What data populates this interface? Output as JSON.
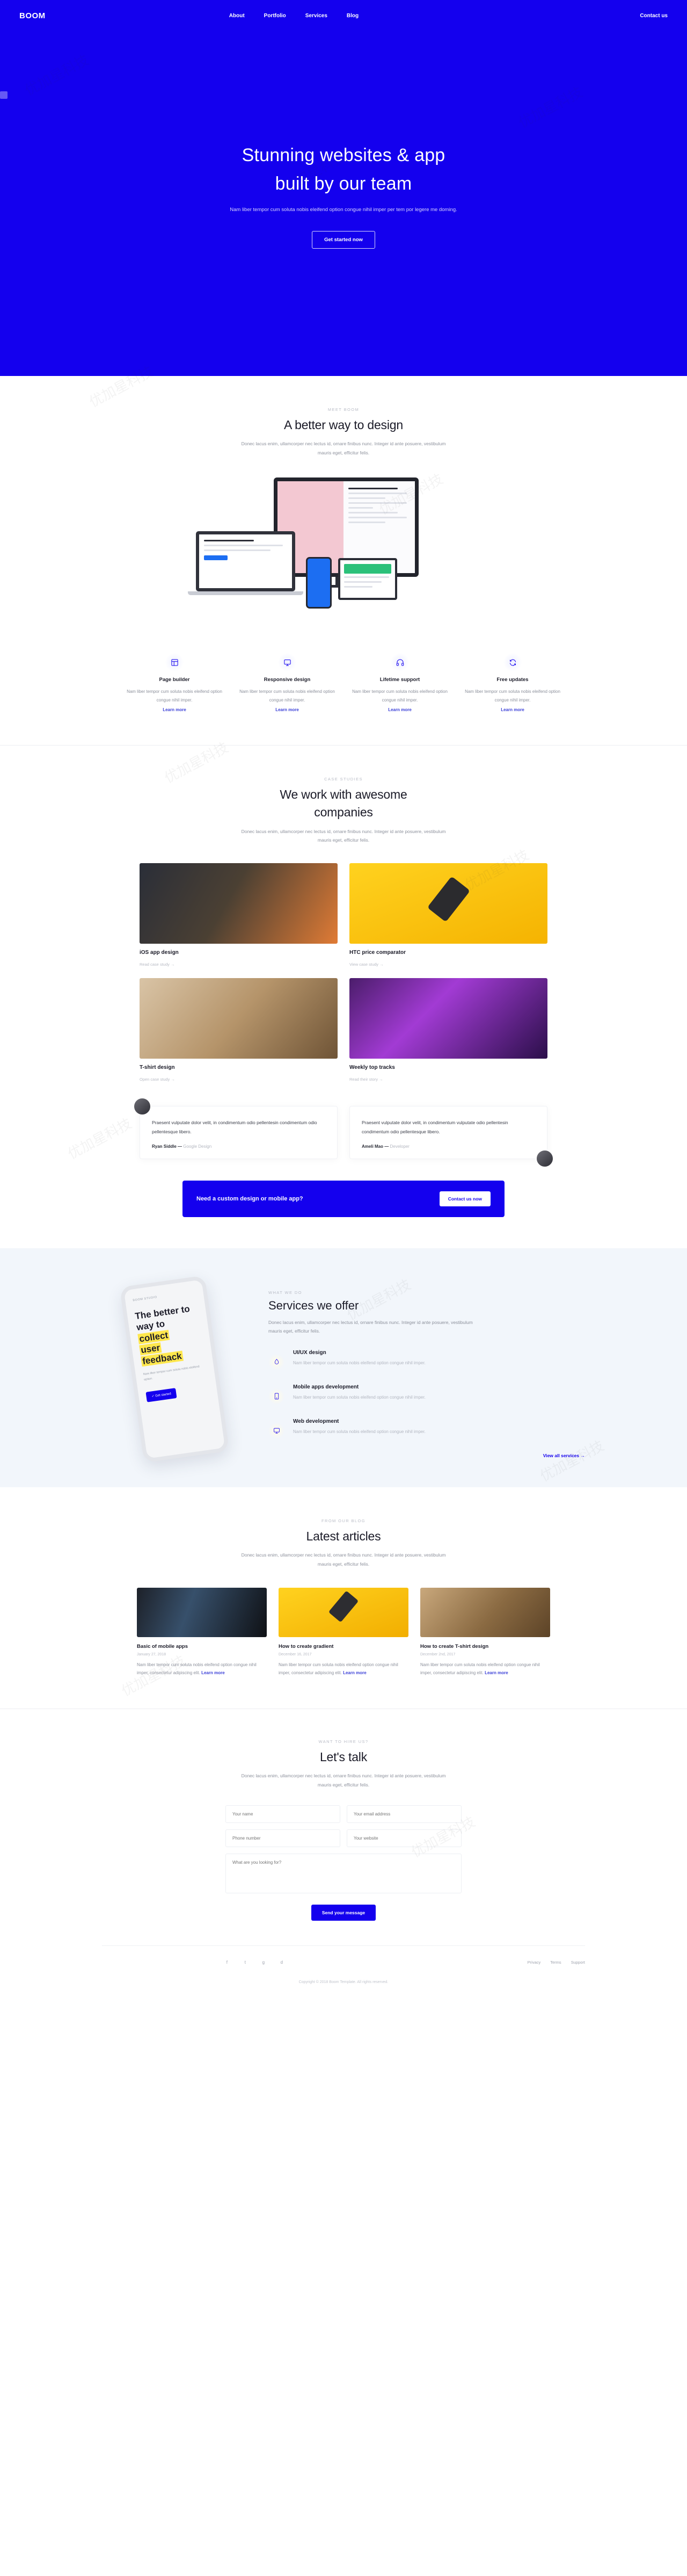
{
  "brand": {
    "name": "BOOM",
    "accent": "#1400ee"
  },
  "nav": {
    "links": [
      "About",
      "Portfolio",
      "Services",
      "Blog"
    ],
    "contact": "Contact us"
  },
  "hero": {
    "title_line1": "Stunning websites & app",
    "title_line2": "built by our team",
    "lead": "Nam liber tempor cum soluta nobis eleifend option congue nihil imper per tem por legere me doming.",
    "cta": "Get started now"
  },
  "meet": {
    "eyebrow": "MEET BOOM",
    "title": "A better way to design",
    "lead": "Donec lacus enim, ullamcorper nec lectus id, ornare finibus nunc. Integer id ante posuere, vestibulum mauris eget, efficitur felis."
  },
  "features": [
    {
      "icon": "layout-icon",
      "title": "Page builder",
      "text": "Nam liber tempor cum soluta nobis eleifend option congue nihil imper.",
      "link": "Learn more"
    },
    {
      "icon": "monitor-icon",
      "title": "Responsive design",
      "text": "Nam liber tempor cum soluta nobis eleifend option congue nihil imper.",
      "link": "Learn more"
    },
    {
      "icon": "headphones-icon",
      "title": "Lifetime support",
      "text": "Nam liber tempor cum soluta nobis eleifend option congue nihil imper.",
      "link": "Learn more"
    },
    {
      "icon": "refresh-icon",
      "title": "Free updates",
      "text": "Nam liber tempor cum soluta nobis eleifend option congue nihil imper.",
      "link": "Learn more"
    }
  ],
  "cases": {
    "eyebrow": "CASE STUDIES",
    "title_line1": "We work with awesome",
    "title_line2": "companies",
    "lead": "Donec lacus enim, ullamcorper nec lectus id, ornare finibus nunc. Integer id ante posuere, vestibulum mauris eget, efficitur felis.",
    "items": [
      {
        "title": "iOS app design",
        "link": "Read case study  →"
      },
      {
        "title": "HTC price comparator",
        "link": "View case study  →"
      },
      {
        "title": "T-shirt design",
        "link": "Open case study  →"
      },
      {
        "title": "Weekly top tracks",
        "link": "Read their story  →"
      }
    ]
  },
  "testimonials": [
    {
      "quote": "Praesent vulputate dolor velit, in condimentum odio pellentesin condimentum odio pellentesque libero.",
      "author": "Ryan Siddle",
      "role": "Google Design"
    },
    {
      "quote": "Praesent vulputate dolor velit, in condimentum vulputate odio pellentesin condimentum odio pellentesque libero.",
      "author": "Ameli Mao",
      "role": "Developer"
    }
  ],
  "cta_bar": {
    "text": "Need a custom design or mobile app?",
    "button": "Contact us now"
  },
  "services": {
    "eyebrow": "WHAT WE DO",
    "title": "Services we offer",
    "lead": "Donec lacus enim, ullamcorper nec lectus id, ornare finibus nunc. Integer id ante posuere, vestibulum mauris eget, efficitur felis.",
    "phone": {
      "caption": "BOOM STUDIO",
      "title_a": "The better to",
      "title_b": "way to",
      "title_c": "collect",
      "title_d": "user",
      "title_e": "feedback",
      "note": "Nam liber tempor cum soluta nobis eleifend option.",
      "button": "✓ Get started"
    },
    "items": [
      {
        "icon": "droplet-icon",
        "title": "UI/UX design",
        "text": "Nam liber tempor cum soluta nobis eleifend option congue nihil imper."
      },
      {
        "icon": "mobile-icon",
        "title": "Mobile apps development",
        "text": "Nam liber tempor cum soluta nobis eleifend option congue nihil imper."
      },
      {
        "icon": "monitor-icon",
        "title": "Web development",
        "text": "Nam liber tempor cum soluta nobis eleifend option congue nihil imper."
      }
    ],
    "view_all": "View all services  →"
  },
  "blog": {
    "eyebrow": "FROM OUR BLOG",
    "title": "Latest articles",
    "lead": "Donec lacus enim, ullamcorper nec lectus id, ornare finibus nunc. Integer id ante posuere, vestibulum mauris eget, efficitur felis.",
    "posts": [
      {
        "title": "Basic of mobile apps",
        "date": "January 27, 2018",
        "text": "Nam liber tempor cum soluta nobis eleifend option congue nihil imper, consectetur adipiscing elit.",
        "link": "Learn more"
      },
      {
        "title": "How to create gradient",
        "date": "December 16, 2017",
        "text": "Nam liber tempor cum soluta nobis eleifend option congue nihil imper, consectetur adipiscing elit.",
        "link": "Learn more"
      },
      {
        "title": "How to create T-shirt design",
        "date": "December 2nd, 2017",
        "text": "Nam liber tempor cum soluta nobis eleifend option congue nihil imper, consectetur adipiscing elit.",
        "link": "Learn more"
      }
    ]
  },
  "contact": {
    "eyebrow": "WANT TO HIRE US?",
    "title": "Let's talk",
    "lead": "Donec lacus enim, ullamcorper nec lectus id, ornare finibus nunc. Integer id ante posuere, vestibulum mauris eget, efficitur felis.",
    "fields": {
      "name": "Your name",
      "email": "Your email address",
      "phone": "Phone number",
      "website": "Your website",
      "message": "What are you looking for?"
    },
    "submit": "Send your message"
  },
  "footer": {
    "socials": [
      "facebook-icon",
      "twitter-icon",
      "google-plus-icon",
      "dribbble-icon"
    ],
    "links": [
      "Privacy",
      "Terms",
      "Support"
    ],
    "copyright": "Copyright © 2018 Boom Template. All rights reserved."
  }
}
